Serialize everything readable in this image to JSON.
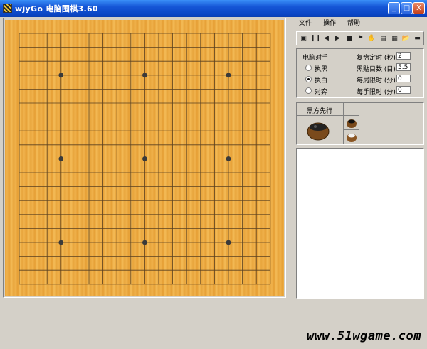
{
  "window": {
    "title": "wjyGo 电脑围棋3.60",
    "minimize_glyph": "_",
    "maximize_glyph": "□",
    "close_glyph": "X"
  },
  "menu": [
    "文件",
    "操作",
    "帮助"
  ],
  "toolbar": {
    "icons": [
      "new-game-icon",
      "pause-icon",
      "back-icon",
      "play-icon",
      "stop-icon",
      "flag-icon",
      "hint-icon",
      "analyze-icon",
      "folder-icon",
      "open-icon",
      "save-icon"
    ],
    "glyphs": [
      "▣",
      "❙❙",
      "◀",
      "▶",
      "■",
      "⚑",
      "✋",
      "▤",
      "▦",
      "📂",
      "▬"
    ]
  },
  "settings": {
    "group_label": "电脑对手",
    "options": [
      "执黑",
      "执白",
      "对弈"
    ],
    "selected_option": "执白",
    "fields": [
      {
        "label": "复盘定时 (秒)",
        "value": "2"
      },
      {
        "label": "黑贴目数 (目)",
        "value": "5.5"
      },
      {
        "label": "每局限时 (分)",
        "value": "0"
      },
      {
        "label": "每手限时 (分)",
        "value": "0"
      }
    ]
  },
  "status": {
    "first_move_label": "黑方先行"
  },
  "board": {
    "size": 19,
    "star_points": [
      [
        3,
        3
      ],
      [
        9,
        3
      ],
      [
        15,
        3
      ],
      [
        3,
        9
      ],
      [
        9,
        9
      ],
      [
        15,
        9
      ],
      [
        3,
        15
      ],
      [
        9,
        15
      ],
      [
        15,
        15
      ]
    ],
    "wood_color": "#f0b24c",
    "line_color": "#5a4020"
  },
  "watermark": "www.51wgame.com"
}
